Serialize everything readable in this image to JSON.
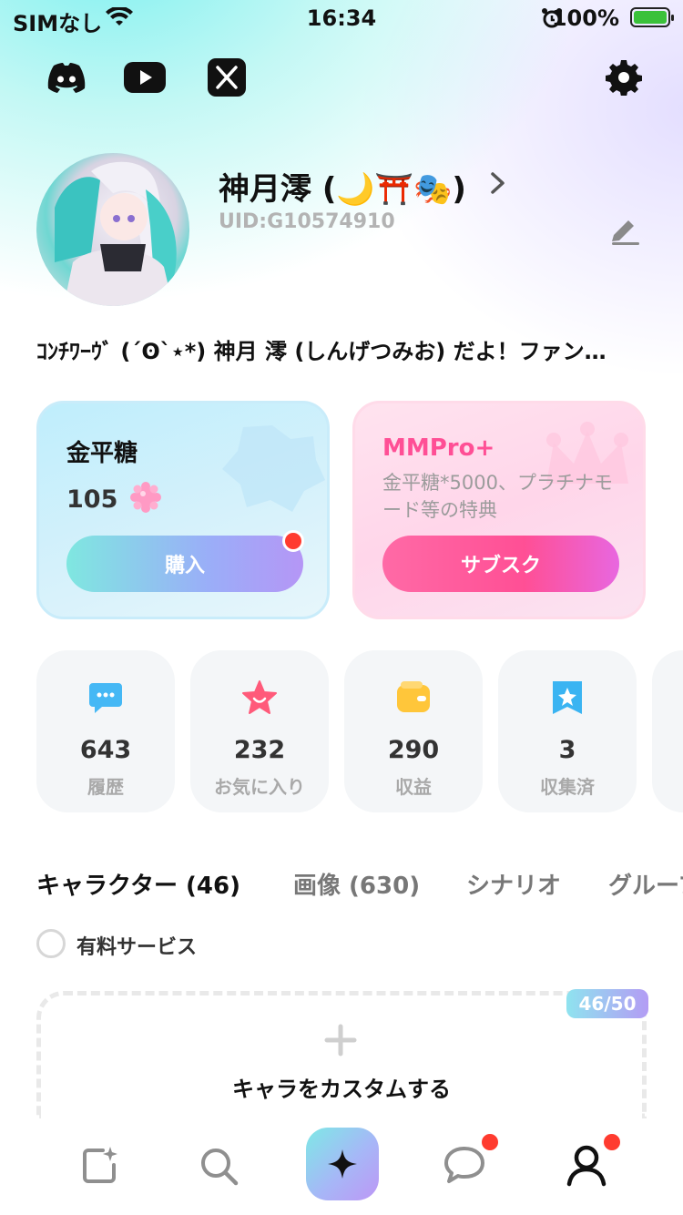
{
  "status_bar": {
    "carrier": "SIMなし",
    "time": "16:34",
    "battery_percent": "100%"
  },
  "social": {
    "discord": "discord-icon",
    "youtube": "youtube-icon",
    "x": "x-icon",
    "settings": "gear-icon"
  },
  "profile": {
    "name": "神月澪 (🌙⛩️🎭)",
    "uid": "UID:G10574910",
    "bio": "ｺﾝﾁﾜｰｳﾞ (´ʘ`⋆*) 神月 澪 (しんげつみお) だよ！ファン…"
  },
  "currency_card": {
    "title": "金平糖",
    "amount": "105",
    "button": "購入"
  },
  "subscription_card": {
    "title": "MMPro+",
    "description": "金平糖*5000、プラチナモード等の特典",
    "button": "サブスク"
  },
  "stats": [
    {
      "value": "643",
      "label": "履歴",
      "icon": "chat-bubble-icon",
      "color": "#45b8f5"
    },
    {
      "value": "232",
      "label": "お気に入り",
      "icon": "star-face-icon",
      "color": "#ff5a7a"
    },
    {
      "value": "290",
      "label": "収益",
      "icon": "wallet-icon",
      "color": "#ffc63a"
    },
    {
      "value": "3",
      "label": "収集済",
      "icon": "bookmark-star-icon",
      "color": "#3ab4f2"
    }
  ],
  "tabs": [
    {
      "label": "キャラクター (46)",
      "active": true
    },
    {
      "label": "画像 (630)",
      "active": false
    },
    {
      "label": "シナリオ",
      "active": false
    },
    {
      "label": "グループ",
      "active": false
    }
  ],
  "filter": {
    "label": "有料サービス"
  },
  "create_card": {
    "badge": "46/50",
    "label": "キャラをカスタムする"
  },
  "bottom_nav": [
    "create-icon",
    "search-icon",
    "sparkle-icon",
    "chat-icon",
    "profile-icon"
  ]
}
